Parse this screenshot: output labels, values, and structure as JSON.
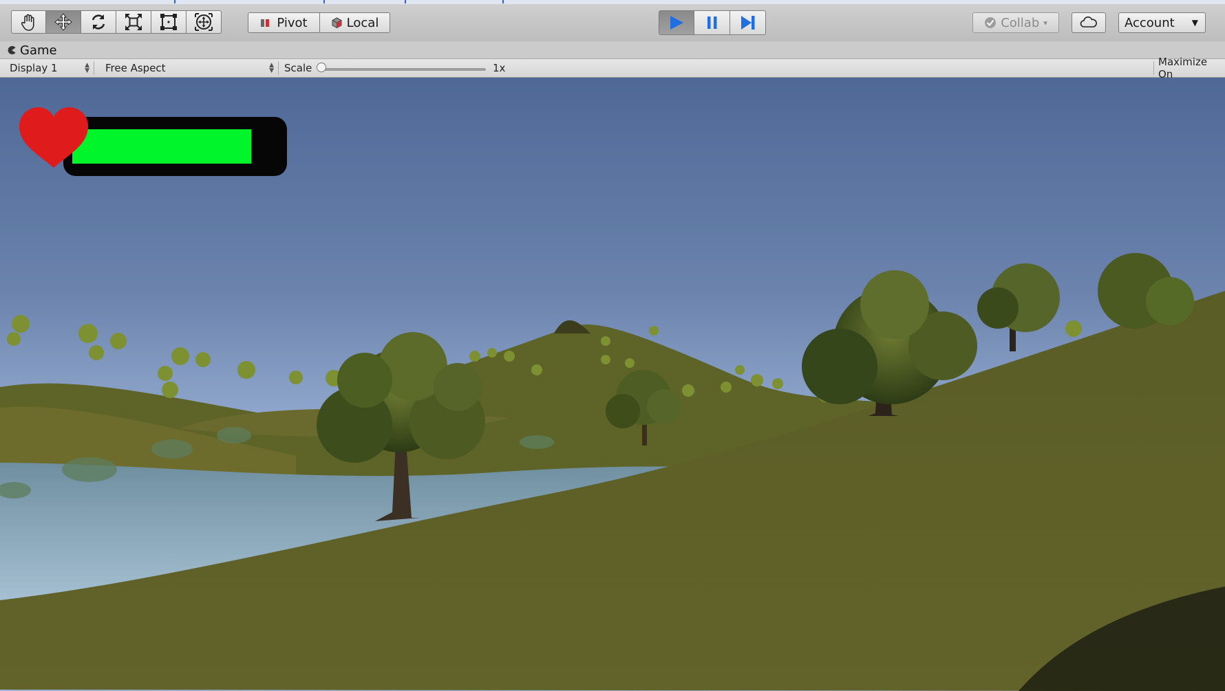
{
  "toolbar": {
    "transform_tools": [
      {
        "name": "hand-tool",
        "icon": "hand-icon"
      },
      {
        "name": "move-tool",
        "icon": "move-arrows-icon"
      },
      {
        "name": "rotate-tool",
        "icon": "rotate-icon"
      },
      {
        "name": "scale-tool",
        "icon": "scale-icon"
      },
      {
        "name": "rect-tool",
        "icon": "rect-transform-icon"
      },
      {
        "name": "transform-tool",
        "icon": "transform-icon"
      }
    ],
    "active_tool": "move-tool",
    "pivot_label": "Pivot",
    "local_label": "Local",
    "collab_label": "Collab",
    "account_label": "Account",
    "play_color": "#1f6fe0"
  },
  "game_tab": {
    "title": "Game"
  },
  "game_toolbar": {
    "display_label": "Display 1",
    "aspect_label": "Free Aspect",
    "scale_label": "Scale",
    "scale_value": "1x",
    "maximize_label": "Maximize On"
  },
  "hud": {
    "health_fraction": 0.87,
    "bar_color": "#00f52b",
    "heart_color": "#e01b1b"
  }
}
